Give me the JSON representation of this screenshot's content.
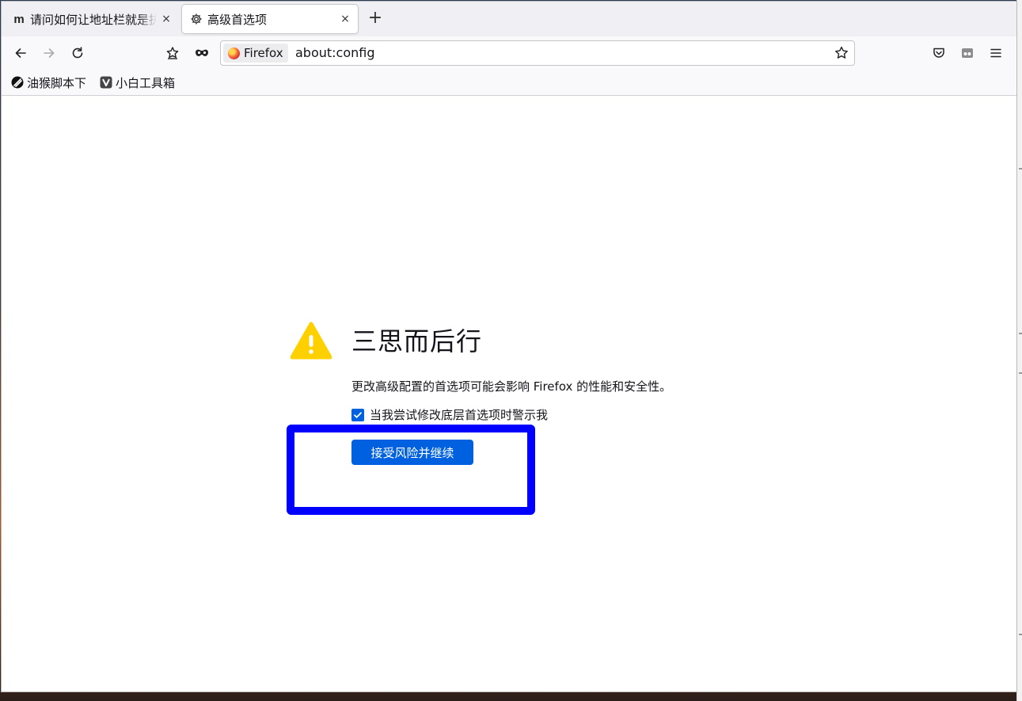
{
  "tabs": [
    {
      "favicon": "m",
      "title": "请问如何让地址栏就是执",
      "active": false
    },
    {
      "favicon": "gear-icon",
      "title": "高级首选项",
      "active": true
    }
  ],
  "tab_close_glyph": "×",
  "new_tab_glyph": "+",
  "url_bar": {
    "identity_label": "Firefox",
    "url": "about:config"
  },
  "bookmarks": [
    {
      "icon": "tampermonkey-icon",
      "label": "油猴脚本下"
    },
    {
      "icon": "v-logo-icon",
      "label": "小白工具箱"
    }
  ],
  "warning_page": {
    "heading": "三思而后行",
    "description": "更改高级配置的首选项可能会影响 Firefox 的性能和安全性。",
    "checkbox_label": "当我尝试修改底层首选项时警示我",
    "checkbox_checked": true,
    "accept_button_label": "接受风险并继续"
  },
  "colors": {
    "accent": "#0061e0",
    "warning": "#ffd000",
    "annotation": "#0000ff"
  }
}
